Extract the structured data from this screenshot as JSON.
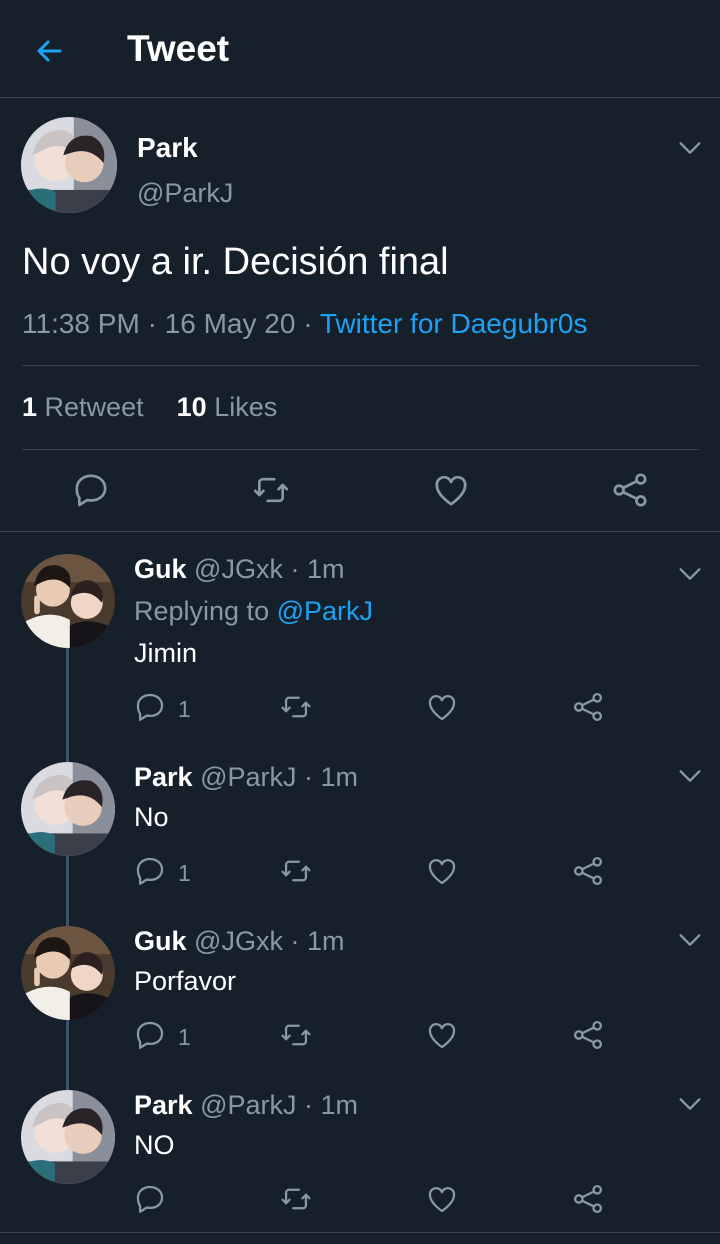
{
  "colors": {
    "background": "#15202b",
    "accent": "#1da1f2",
    "muted": "#8899a6",
    "divider": "#38444d"
  },
  "header": {
    "title": "Tweet",
    "back_icon": "arrow-left-icon"
  },
  "main_tweet": {
    "name": "Park",
    "handle": "@ParkJ",
    "text": "No voy a ir. Decisión final",
    "time": "11:38 PM",
    "date": "16 May 20",
    "source": "Twitter for Daegubr0s",
    "retweets_count": "1",
    "retweets_label": "Retweet",
    "likes_count": "10",
    "likes_label": "Likes"
  },
  "replies": [
    {
      "name": "Guk",
      "handle": "@JGxk",
      "time": "1m",
      "replying_label": "Replying to",
      "replying_to": "@ParkJ",
      "text": "Jimin",
      "reply_count": "1"
    },
    {
      "name": "Park",
      "handle": "@ParkJ",
      "time": "1m",
      "text": "No",
      "reply_count": "1"
    },
    {
      "name": "Guk",
      "handle": "@JGxk",
      "time": "1m",
      "text": "Porfavor",
      "reply_count": "1"
    },
    {
      "name": "Park",
      "handle": "@ParkJ",
      "time": "1m",
      "text": "NO",
      "reply_count": ""
    }
  ]
}
